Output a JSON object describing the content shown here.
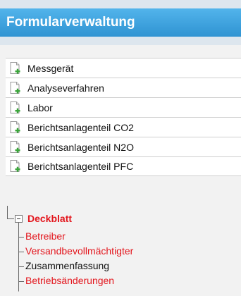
{
  "header": {
    "title": "Formularverwaltung"
  },
  "forms": [
    {
      "label": "Messgerät",
      "icon": "document-add-icon"
    },
    {
      "label": "Analyseverfahren",
      "icon": "document-add-icon"
    },
    {
      "label": "Labor",
      "icon": "document-add-icon"
    },
    {
      "label": "Berichtsanlagenteil CO2",
      "icon": "document-add-icon"
    },
    {
      "label": "Berichtsanlagenteil N2O",
      "icon": "document-add-icon"
    },
    {
      "label": "Berichtsanlagenteil PFC",
      "icon": "document-add-icon"
    }
  ],
  "tree": {
    "root": {
      "label": "Deckblatt",
      "color": "#e3161d",
      "expanded": true
    },
    "children": [
      {
        "label": "Betreiber",
        "color": "#e3161d"
      },
      {
        "label": "Versandbevollmächtigter",
        "color": "#e3161d"
      },
      {
        "label": "Zusammenfassung",
        "color": "#111111"
      },
      {
        "label": "Betriebsänderungen",
        "color": "#e3161d"
      }
    ]
  },
  "colors": {
    "header_gradient_top": "#52b4eb",
    "header_gradient_bottom": "#2f93d2",
    "header_band": "#dde6ee",
    "page_background": "#f2f2f2",
    "icon_plus_green": "#3aa53a"
  }
}
